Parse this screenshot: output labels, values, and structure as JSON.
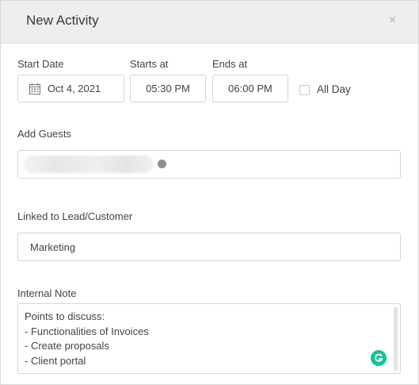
{
  "dialog": {
    "title": "New Activity",
    "close_icon": "×"
  },
  "fields": {
    "start_date_label": "Start Date",
    "start_date_value": "Oct 4, 2021",
    "starts_at_label": "Starts at",
    "starts_at_value": "05:30 PM",
    "ends_at_label": "Ends at",
    "ends_at_value": "06:00 PM",
    "all_day_label": "All Day",
    "all_day_checked": false,
    "add_guests_label": "Add Guests",
    "linked_label": "Linked to Lead/Customer",
    "linked_value": "Marketing",
    "internal_note_label": "Internal Note",
    "internal_note_value": "Points to discuss:\n- Functionalities of Invoices\n- Create proposals\n- Client portal"
  },
  "icons": {
    "calendar": "calendar-icon",
    "grammarly": "grammarly-icon",
    "close": "close-icon"
  },
  "colors": {
    "header_bg": "#eeeeee",
    "grammarly_green": "#15c39a"
  }
}
